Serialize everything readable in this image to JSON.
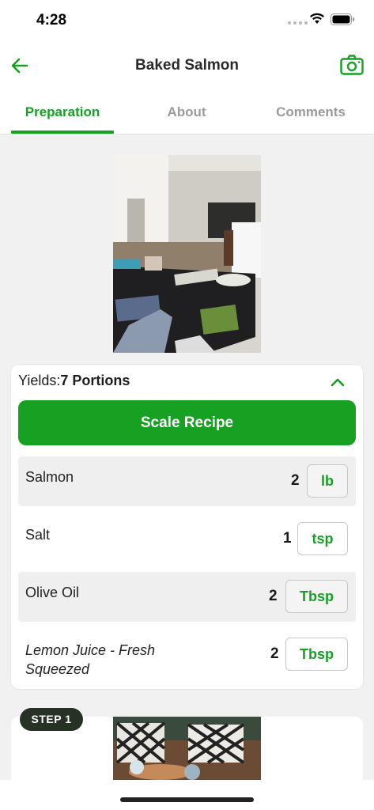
{
  "status_bar": {
    "time": "4:28"
  },
  "nav": {
    "title": "Baked Salmon",
    "back_icon": "arrow-left-icon",
    "camera_icon": "camera-icon"
  },
  "tabs": [
    {
      "label": "Preparation",
      "active": true
    },
    {
      "label": "About",
      "active": false
    },
    {
      "label": "Comments",
      "active": false
    }
  ],
  "yields": {
    "label": "Yields:",
    "value": "7 Portions"
  },
  "scale_button": {
    "label": "Scale Recipe"
  },
  "ingredients": [
    {
      "name": "Salmon",
      "qty": "2",
      "unit": "lb"
    },
    {
      "name": "Salt",
      "qty": "1",
      "unit": "tsp"
    },
    {
      "name": "Olive Oil",
      "qty": "2",
      "unit": "Tbsp"
    },
    {
      "name": "Lemon Juice - Fresh Squeezed",
      "qty": "2",
      "unit": "Tbsp"
    }
  ],
  "step": {
    "badge": "STEP 1"
  },
  "colors": {
    "accent": "#16a025",
    "badge_bg": "#253224",
    "page_bg": "#f1f1f1"
  }
}
